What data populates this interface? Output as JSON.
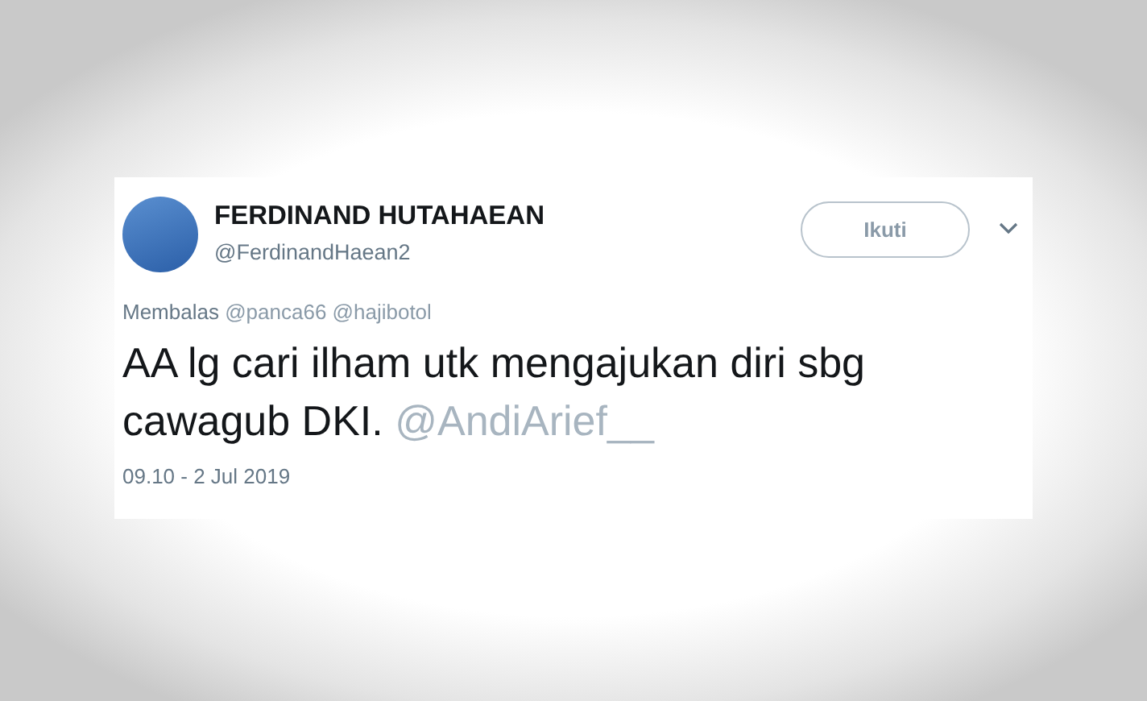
{
  "author": {
    "name": "FERDINAND HUTAHAEAN",
    "handle": "@FerdinandHaean2"
  },
  "follow_button": "Ikuti",
  "reply_context": {
    "label": "Membalas",
    "mentions": [
      "@panca66",
      "@hajibotol"
    ]
  },
  "tweet": {
    "text": "AA lg cari ilham utk mengajukan diri sbg cawagub DKI.",
    "mention": "@AndiArief__"
  },
  "timestamp": "09.10 - 2 Jul 2019"
}
